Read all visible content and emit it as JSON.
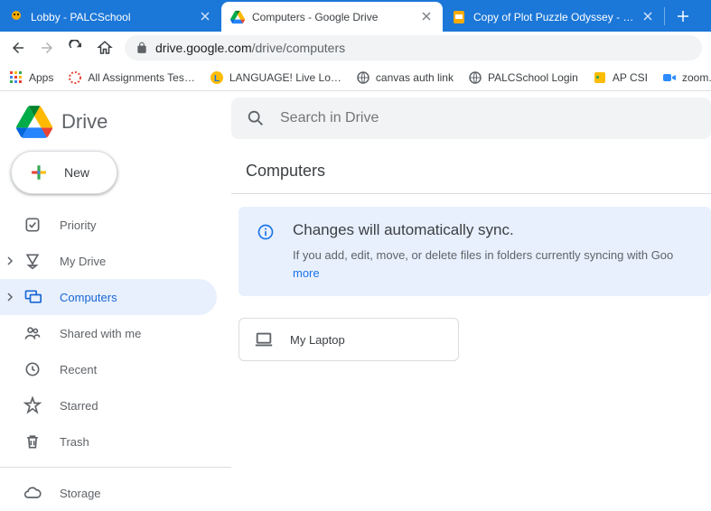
{
  "browser": {
    "tabs": [
      {
        "title": "Lobby - PALCSchool"
      },
      {
        "title": "Computers - Google Drive"
      },
      {
        "title": "Copy of Plot Puzzle Odyssey - Go"
      }
    ],
    "url_domain": "drive.google.com",
    "url_path": "/drive/computers",
    "bookmarks": [
      {
        "label": "Apps"
      },
      {
        "label": "All Assignments Tes…"
      },
      {
        "label": "LANGUAGE! Live Lo…"
      },
      {
        "label": "canvas auth link"
      },
      {
        "label": "PALCSchool Login"
      },
      {
        "label": "AP CSI"
      },
      {
        "label": "zoom.us"
      }
    ]
  },
  "drive": {
    "brand": "Drive",
    "new_button": "New",
    "search_placeholder": "Search in Drive",
    "page_title": "Computers",
    "sidebar": {
      "priority": "Priority",
      "my_drive": "My Drive",
      "computers": "Computers",
      "shared": "Shared with me",
      "recent": "Recent",
      "starred": "Starred",
      "trash": "Trash",
      "storage": "Storage"
    },
    "banner": {
      "title": "Changes will automatically sync.",
      "desc": "If you add, edit, move, or delete files in folders currently syncing with Goo",
      "learn_more": "more"
    },
    "devices": [
      {
        "name": "My Laptop"
      }
    ]
  }
}
